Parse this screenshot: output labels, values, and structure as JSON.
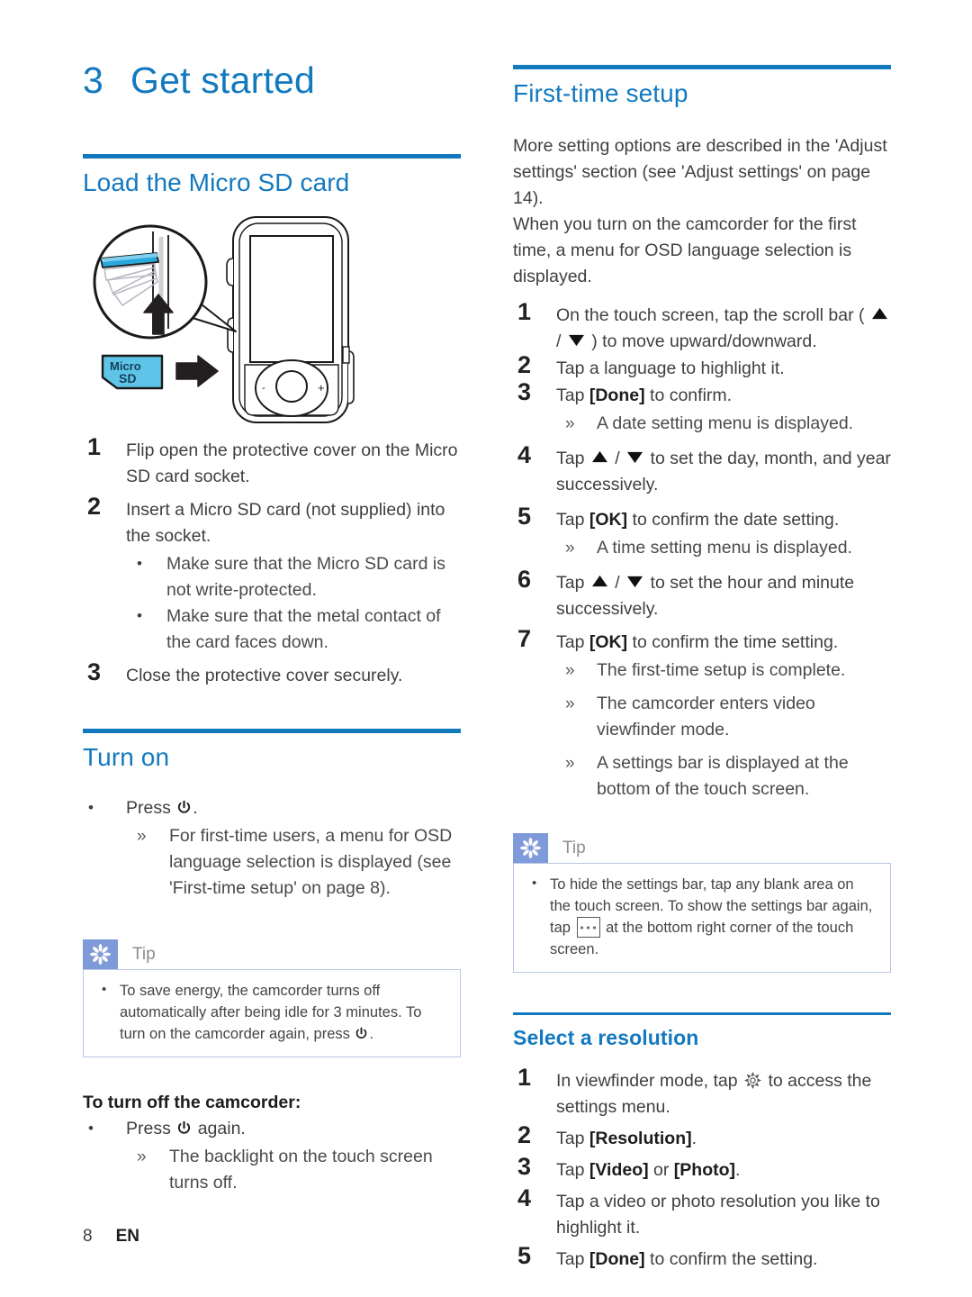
{
  "colors": {
    "heading_blue": "#1379bf",
    "tip_badge": "#7f9ad9",
    "tip_border": "#b9c6e4",
    "sd_card_blue": "#5ec5e8",
    "cover_flap_blue": "#29a8dc"
  },
  "chapter": {
    "number": "3",
    "title": "Get started"
  },
  "left_column": {
    "load_card": {
      "heading": "Load the Micro SD card",
      "illustration": {
        "name": "camcorder-micro-sd-insert-diagram",
        "sd_card_label": "Micro SD",
        "control_minus": "-",
        "control_plus": "+"
      },
      "steps": [
        {
          "text": "Flip open the protective cover on the Micro SD card socket.",
          "sub": []
        },
        {
          "text": "Insert a Micro SD card (not supplied) into the socket.",
          "sub": [
            "Make sure that the Micro SD card is not write-protected.",
            "Make sure that the metal contact of the card faces down."
          ]
        },
        {
          "text": "Close the protective cover securely.",
          "sub": []
        }
      ]
    },
    "turn_on": {
      "heading": "Turn on",
      "bullet_prefix": "Press",
      "bullet_suffix": ".",
      "arrow_items": [
        "For first-time users, a menu for OSD language selection is displayed (see 'First-time setup' on page 8)."
      ],
      "tip": {
        "label": "Tip",
        "items": [
          "To save energy, the camcorder turns off automatically after being idle for 3 minutes. To turn on the camcorder again, press"
        ],
        "item_suffix": "."
      },
      "turn_off_heading": "To turn off the camcorder:",
      "turn_off_bullet_prefix": "Press",
      "turn_off_bullet_suffix": "again.",
      "turn_off_arrow_items": [
        "The backlight on the touch screen turns off."
      ]
    }
  },
  "right_column": {
    "first_time_setup": {
      "heading": "First-time setup",
      "intro": "More setting options are described in the 'Adjust settings' section (see 'Adjust settings' on page 14).\nWhen you turn on the camcorder for the first time, a menu for OSD language selection is displayed.",
      "steps": [
        {
          "parts": [
            "On the touch screen, tap the scroll bar ( ",
            "TRI_UP",
            " / ",
            "TRI_DOWN",
            " ) to move upward/downward."
          ],
          "sub_arrows": []
        },
        {
          "parts": [
            "Tap a language to highlight it."
          ],
          "sub_arrows": []
        },
        {
          "parts": [
            "Tap ",
            "BTN:[Done]",
            " to confirm."
          ],
          "sub_arrows": [
            "A date setting menu is displayed."
          ]
        },
        {
          "parts": [
            "Tap ",
            "TRI_UP",
            " / ",
            "TRI_DOWN",
            " to set the day, month, and year successively."
          ],
          "sub_arrows": []
        },
        {
          "parts": [
            "Tap ",
            "BTN:[OK]",
            " to confirm the date setting."
          ],
          "sub_arrows": [
            "A time setting menu is displayed."
          ]
        },
        {
          "parts": [
            "Tap ",
            "TRI_UP",
            " / ",
            "TRI_DOWN",
            " to set the hour and minute successively."
          ],
          "sub_arrows": []
        },
        {
          "parts": [
            "Tap ",
            "BTN:[OK]",
            " to confirm the time setting."
          ],
          "sub_arrows": [
            "The first-time setup is complete.",
            "The camcorder enters video viewfinder mode.",
            "A settings bar is displayed at the bottom of the touch screen."
          ]
        }
      ],
      "tip": {
        "label": "Tip",
        "text_before": "To hide the settings bar, tap any blank area on the touch screen. To show the settings bar again, tap",
        "text_after": "at the bottom right corner of the touch screen."
      }
    },
    "select_resolution": {
      "heading": "Select a resolution",
      "steps": [
        {
          "text_before": "In viewfinder mode, tap",
          "icon": "gear-icon",
          "text_after": "to access the settings menu."
        },
        {
          "text_before": "Tap",
          "bold": "[Resolution]",
          "text_after": "."
        },
        {
          "text_before": "Tap",
          "bold": "[Video]",
          "mid": "or",
          "bold2": "[Photo]",
          "text_after": "."
        },
        {
          "text_before": "Tap a video or photo resolution you like to highlight it."
        },
        {
          "text_before": "Tap",
          "bold": "[Done]",
          "text_after": "to confirm the setting."
        }
      ]
    }
  },
  "footer": {
    "page_number": "8",
    "language_code": "EN"
  }
}
